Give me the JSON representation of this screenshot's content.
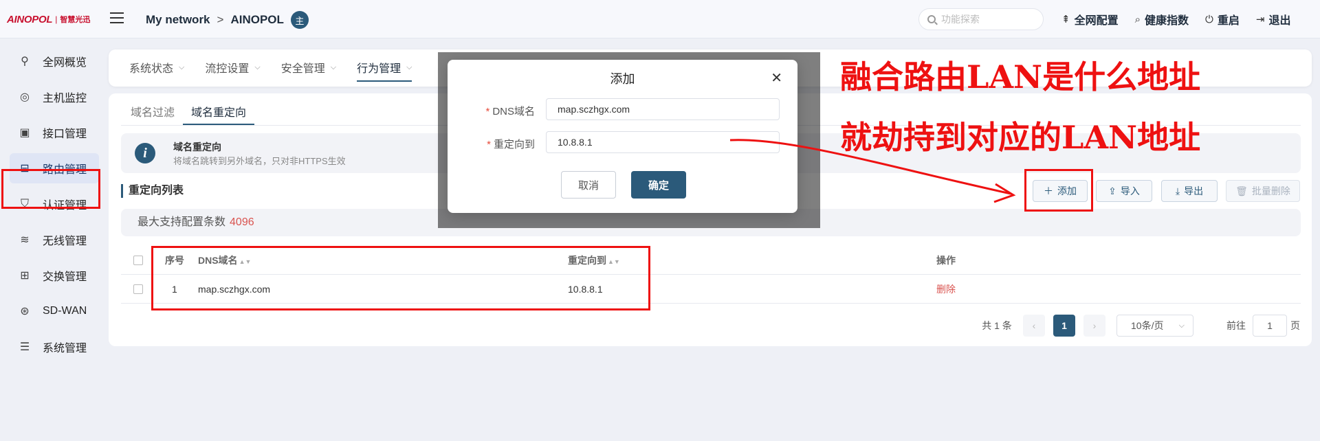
{
  "header": {
    "brand": "AINOPOL",
    "brand_sub": "智慧光迅",
    "breadcrumb_root": "My network",
    "breadcrumb_current": "AINOPOL",
    "role_badge": "主",
    "search_placeholder": "功能探索",
    "tools": [
      "全网配置",
      "健康指数",
      "重启",
      "退出"
    ]
  },
  "sidebar": {
    "items": [
      {
        "label": "全网概览",
        "icon": "network-icon"
      },
      {
        "label": "主机监控",
        "icon": "user-monitor-icon"
      },
      {
        "label": "接口管理",
        "icon": "interface-icon"
      },
      {
        "label": "路由管理",
        "icon": "router-icon",
        "active": true
      },
      {
        "label": "认证管理",
        "icon": "shield-icon"
      },
      {
        "label": "无线管理",
        "icon": "wifi-icon"
      },
      {
        "label": "交换管理",
        "icon": "switch-icon"
      },
      {
        "label": "SD-WAN",
        "icon": "sdwan-icon"
      },
      {
        "label": "系统管理",
        "icon": "settings-sliders-icon"
      }
    ]
  },
  "top_tabs": [
    "系统状态",
    "流控设置",
    "安全管理",
    "行为管理"
  ],
  "sub_tabs": [
    "域名过滤",
    "域名重定向"
  ],
  "info": {
    "title": "域名重定向",
    "desc": "将域名跳转到另外域名，只对非HTTPS生效"
  },
  "list": {
    "title": "重定向列表",
    "buttons": [
      "添加",
      "导入",
      "导出",
      "批量删除"
    ],
    "capacity_label": "最大支持配置条数",
    "capacity_value": "4096",
    "columns": [
      "序号",
      "DNS域名",
      "重定向到",
      "操作"
    ],
    "rows": [
      {
        "index": "1",
        "domain": "map.sczhgx.com",
        "redirect": "10.8.8.1",
        "action": "删除"
      }
    ]
  },
  "pagination": {
    "total": "共 1 条",
    "current_page": "1",
    "page_size": "10条/页",
    "goto_label": "前往",
    "goto_value": "1",
    "page_suffix": "页"
  },
  "dialog": {
    "title": "添加",
    "fields": [
      {
        "label": "DNS域名",
        "value": "map.sczhgx.com"
      },
      {
        "label": "重定向到",
        "value": "10.8.8.1"
      }
    ],
    "cancel": "取消",
    "confirm": "确定",
    "obscured_header": "重定向到"
  },
  "annotations": {
    "line1": "融合路由LAN是什么地址",
    "line2": "就劫持到对应的LAN地址",
    "color": "#ee1111"
  },
  "colors": {
    "primary": "#2b5a7a",
    "danger": "#d9534f",
    "annotation": "#ee1111"
  }
}
